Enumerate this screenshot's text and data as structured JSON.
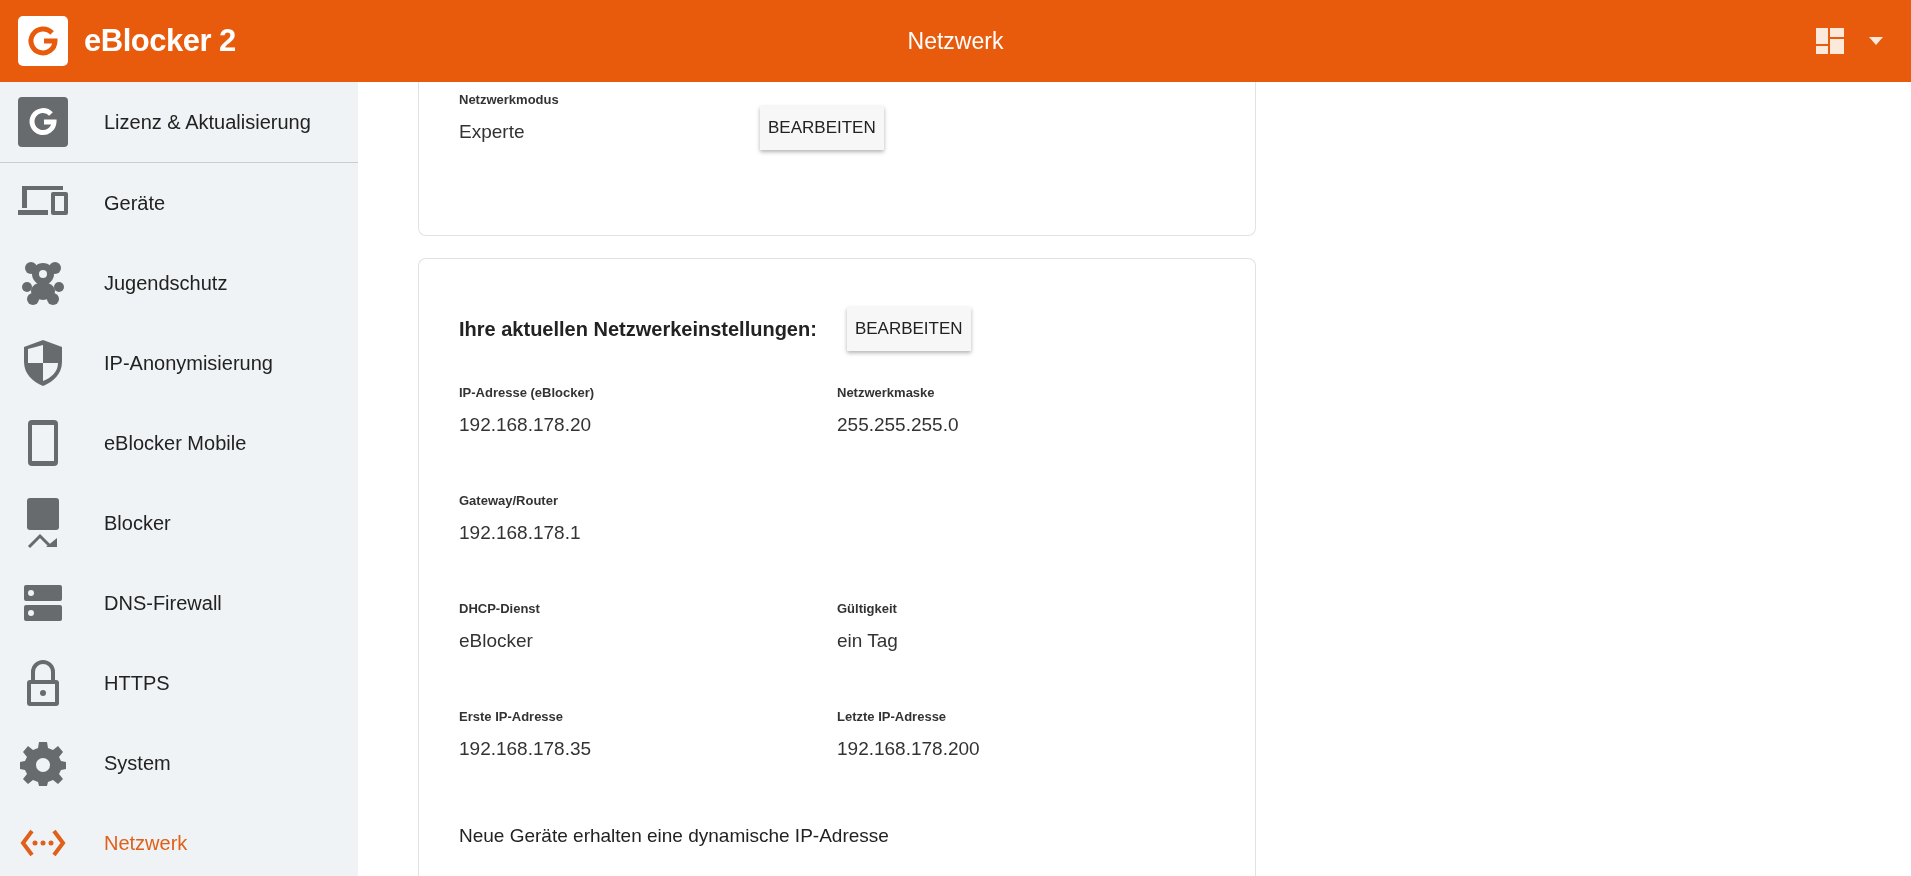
{
  "header": {
    "brand": "eBlocker 2",
    "title": "Netzwerk"
  },
  "sidebar": {
    "items": [
      {
        "kind": "license",
        "label": "Lizenz & Aktualisierung",
        "selected": false
      },
      {
        "kind": "devices",
        "label": "Geräte",
        "selected": false
      },
      {
        "kind": "teddy",
        "label": "Jugendschutz",
        "selected": false
      },
      {
        "kind": "shield",
        "label": "IP-Anonymisierung",
        "selected": false
      },
      {
        "kind": "mobile",
        "label": "eBlocker Mobile",
        "selected": false
      },
      {
        "kind": "blocker",
        "label": "Blocker",
        "selected": false
      },
      {
        "kind": "dns",
        "label": "DNS-Firewall",
        "selected": false
      },
      {
        "kind": "lock",
        "label": "HTTPS",
        "selected": false
      },
      {
        "kind": "gear",
        "label": "System",
        "selected": false
      },
      {
        "kind": "network",
        "label": "Netzwerk",
        "selected": true
      }
    ]
  },
  "mode_card": {
    "label": "Netzwerkmodus",
    "value": "Experte",
    "button": "BEARBEITEN"
  },
  "settings_card": {
    "heading": "Ihre aktuellen Netzwerkeinstellungen:",
    "button": "BEARBEITEN",
    "rows": [
      [
        {
          "label": "IP-Adresse (eBlocker)",
          "value": "192.168.178.20"
        },
        {
          "label": "Netzwerkmaske",
          "value": "255.255.255.0"
        }
      ],
      [
        {
          "label": "Gateway/Router",
          "value": "192.168.178.1"
        }
      ],
      [
        {
          "label": "DHCP-Dienst",
          "value": "eBlocker"
        },
        {
          "label": "Gültigkeit",
          "value": "ein Tag"
        }
      ],
      [
        {
          "label": "Erste IP-Adresse",
          "value": "192.168.178.35"
        },
        {
          "label": "Letzte IP-Adresse",
          "value": "192.168.178.200"
        }
      ]
    ],
    "note": "Neue Geräte erhalten eine dynamische IP-Adresse"
  }
}
